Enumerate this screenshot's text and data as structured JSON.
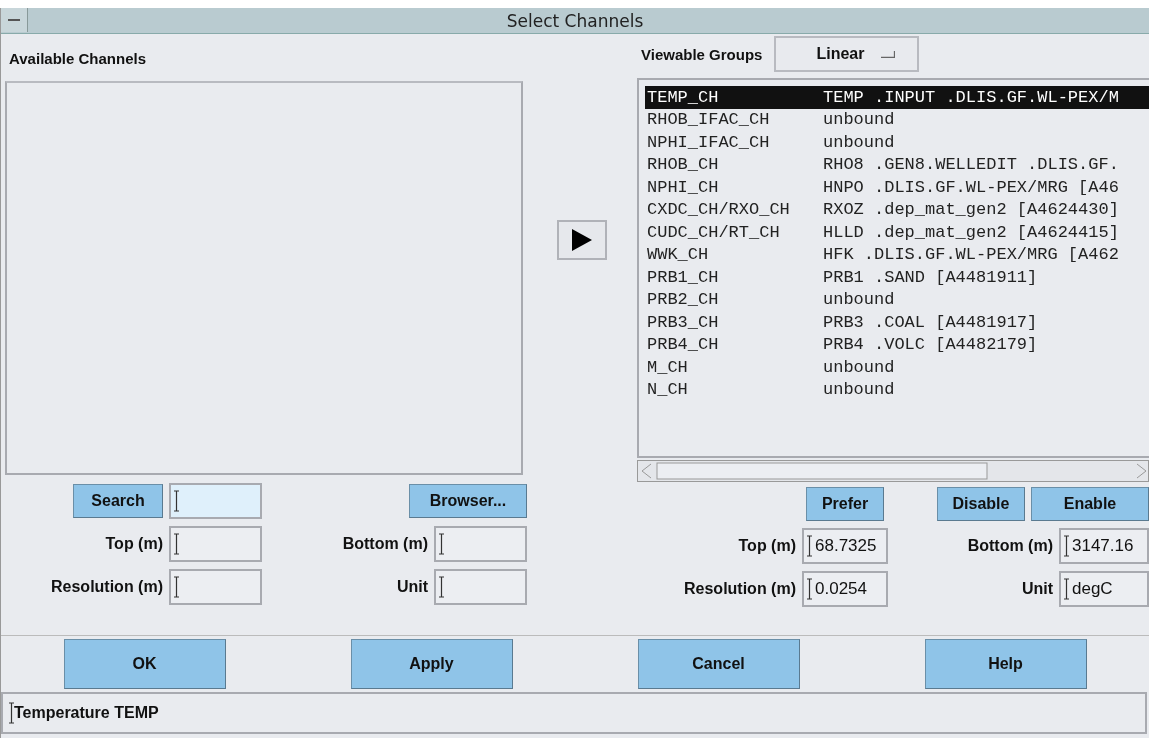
{
  "window": {
    "title": "Select Channels"
  },
  "available_channels": {
    "heading": "Available Channels",
    "search_button": "Search",
    "search_field": {
      "focused": true
    },
    "browser_button": "Browser...",
    "fields": [
      {
        "label": "Top (m)"
      },
      {
        "label": "Bottom (m)"
      },
      {
        "label": "Resolution (m)"
      },
      {
        "label": "Unit"
      }
    ]
  },
  "viewable_groups": {
    "label": "Viewable Groups",
    "dropdown": {
      "value": "Linear"
    },
    "rows": [
      {
        "channel": "TEMP_CH",
        "binding": "TEMP .INPUT .DLIS.GF.WL-PEX/M",
        "selected": true
      },
      {
        "channel": "RHOB_IFAC_CH",
        "binding": "unbound",
        "selected": false
      },
      {
        "channel": "NPHI_IFAC_CH",
        "binding": "unbound",
        "selected": false
      },
      {
        "channel": "RHOB_CH",
        "binding": "RHO8 .GEN8.WELLEDIT .DLIS.GF.",
        "selected": false
      },
      {
        "channel": "NPHI_CH",
        "binding": "HNPO .DLIS.GF.WL-PEX/MRG [A46",
        "selected": false
      },
      {
        "channel": "CXDC_CH/RXO_CH",
        "binding": "RXOZ .dep_mat_gen2 [A4624430]",
        "selected": false
      },
      {
        "channel": "CUDC_CH/RT_CH",
        "binding": "HLLD .dep_mat_gen2 [A4624415]",
        "selected": false
      },
      {
        "channel": "WWK_CH",
        "binding": "HFK .DLIS.GF.WL-PEX/MRG [A462",
        "selected": false
      },
      {
        "channel": "PRB1_CH",
        "binding": "PRB1 .SAND [A4481911]",
        "selected": false
      },
      {
        "channel": "PRB2_CH",
        "binding": "unbound",
        "selected": false
      },
      {
        "channel": "PRB3_CH",
        "binding": "PRB3 .COAL [A4481917]",
        "selected": false
      },
      {
        "channel": "PRB4_CH",
        "binding": "PRB4 .VOLC [A4482179]",
        "selected": false
      },
      {
        "channel": "M_CH",
        "binding": "unbound",
        "selected": false
      },
      {
        "channel": "N_CH",
        "binding": "unbound",
        "selected": false
      }
    ],
    "prefer_button": "Prefer",
    "disable_button": "Disable",
    "enable_button": "Enable",
    "fields": [
      {
        "label": "Top (m)",
        "value": "68.7325"
      },
      {
        "label": "Bottom (m)",
        "value": "3147.16"
      },
      {
        "label": "Resolution (m)",
        "value": "0.0254"
      },
      {
        "label": "Unit",
        "value": "degC"
      }
    ]
  },
  "dialog_buttons": [
    "OK",
    "Apply",
    "Cancel",
    "Help"
  ],
  "status_bar": {
    "text": "Temperature TEMP"
  }
}
